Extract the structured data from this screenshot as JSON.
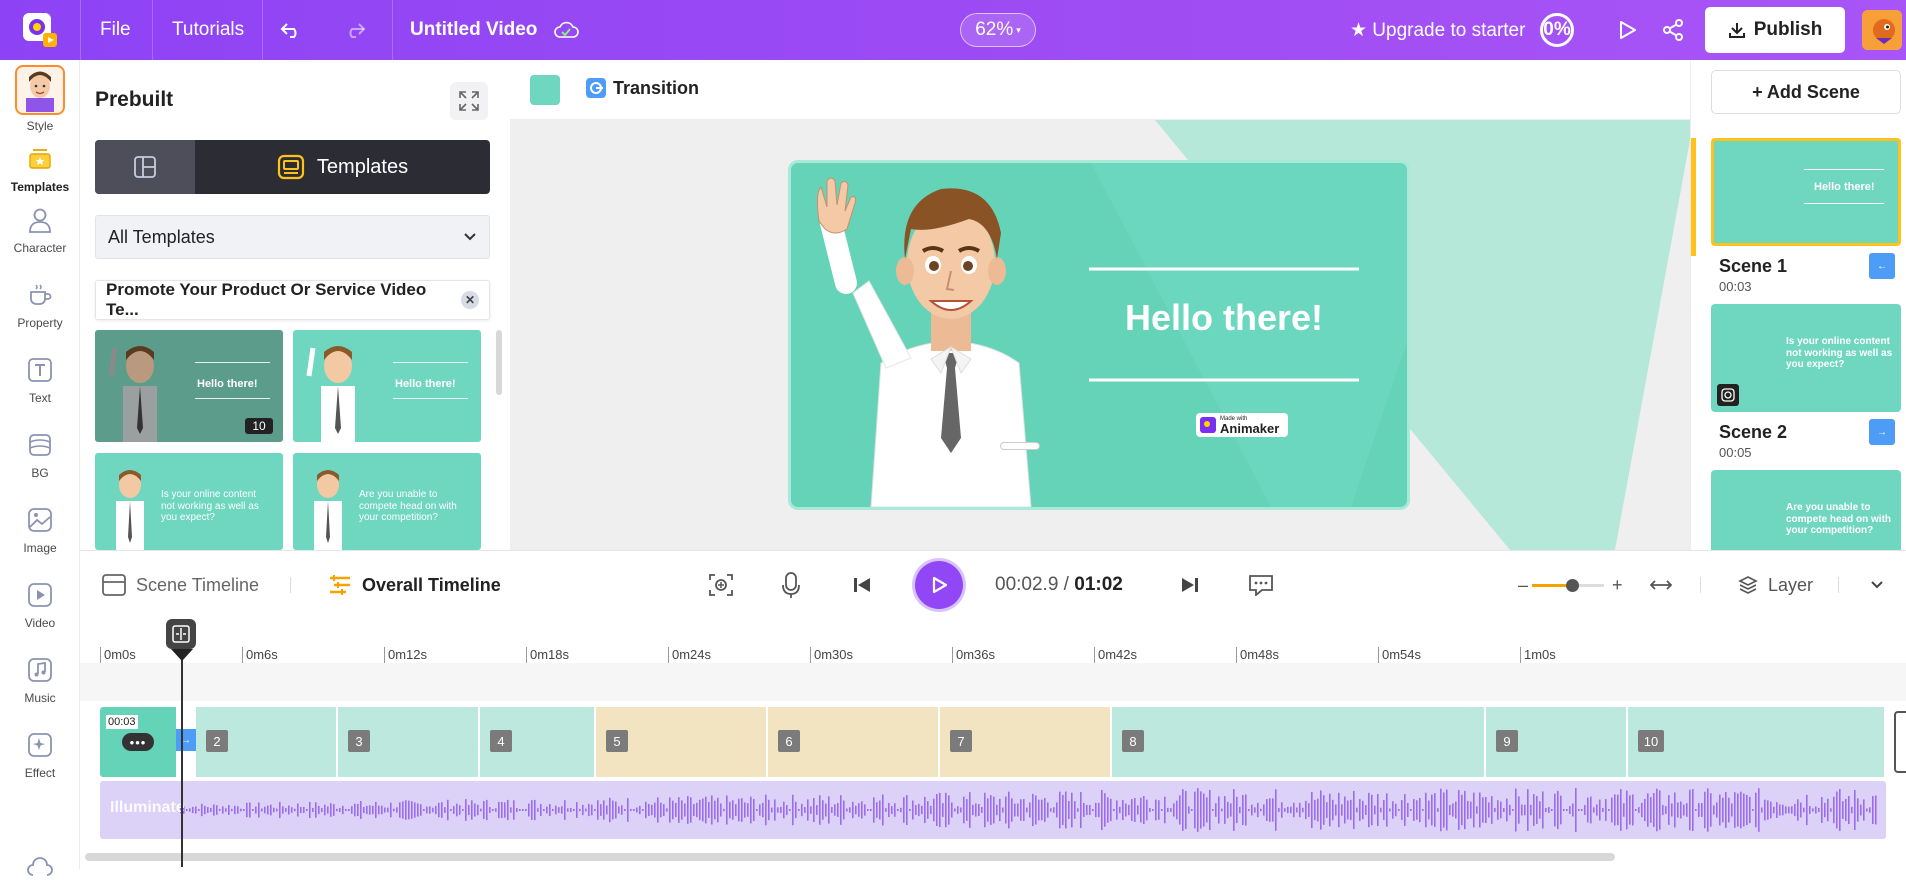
{
  "topbar": {
    "file": "File",
    "tutorials": "Tutorials",
    "title": "Untitled Video",
    "zoom": "62%",
    "upgrade": "★ Upgrade to starter",
    "progress": "0%",
    "publish": "Publish"
  },
  "rail": {
    "items": [
      {
        "label": "Style"
      },
      {
        "label": "Templates"
      },
      {
        "label": "Character"
      },
      {
        "label": "Property"
      },
      {
        "label": "Text"
      },
      {
        "label": "BG"
      },
      {
        "label": "Image"
      },
      {
        "label": "Video"
      },
      {
        "label": "Music"
      },
      {
        "label": "Effect"
      }
    ]
  },
  "panel": {
    "title": "Prebuilt",
    "tab": "Templates",
    "dropdown": "All Templates",
    "chip": "Promote Your Product Or Service Video Te...",
    "thumbs": [
      {
        "text": "Hello there!",
        "badge": "10"
      },
      {
        "text": "Hello there!"
      },
      {
        "text": "Is your online content not working as well as you expect?"
      },
      {
        "text": "Are you unable to compete head on with your competition?"
      }
    ]
  },
  "canvas": {
    "transition": "Transition",
    "headline": "Hello there!",
    "watermark_small": "Made with",
    "watermark": "Animaker"
  },
  "scenes": {
    "add": "+ Add Scene",
    "list": [
      {
        "name": "Scene 1",
        "time": "00:03",
        "text": "Hello there!"
      },
      {
        "name": "Scene 2",
        "time": "00:05",
        "text": "Is your online content not working as well as you expect?"
      },
      {
        "text": "Are you unable to compete head on with your competition?"
      }
    ]
  },
  "timeline": {
    "scene_tab": "Scene Timeline",
    "overall_tab": "Overall Timeline",
    "current": "00:02.9",
    "separator": " / ",
    "total": "01:02",
    "layer": "Layer",
    "zoom_level": 0.55,
    "ticks": [
      "0m0s",
      "0m6s",
      "0m12s",
      "0m18s",
      "0m24s",
      "0m30s",
      "0m36s",
      "0m42s",
      "0m48s",
      "0m54s",
      "1m0s"
    ],
    "first_clip_time": "00:03",
    "segments": [
      "2",
      "3",
      "4",
      "5",
      "6",
      "7",
      "8",
      "9",
      "10"
    ],
    "audio": "Illuminate"
  },
  "colors": {
    "accent": "#9147f5",
    "scene": "#64d3b8",
    "clip_green": "#bde8de",
    "clip_yellow": "#f2e4c0",
    "audio": "#dcd2f7"
  }
}
